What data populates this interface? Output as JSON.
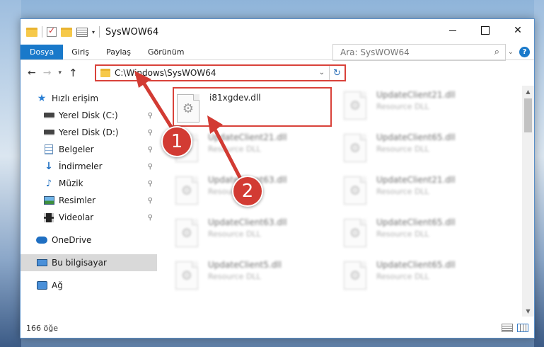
{
  "window": {
    "title": "SysWOW64",
    "buttons": {
      "minimize": "",
      "maximize": "",
      "close": "✕"
    }
  },
  "ribbon": {
    "tabs": [
      "Dosya",
      "Giriş",
      "Paylaş",
      "Görünüm"
    ],
    "help": "?",
    "expand": "⌄"
  },
  "nav": {
    "back": "←",
    "forward": "→",
    "recent": "▾",
    "up": "↑",
    "address": "C:\\Windows\\SysWOW64",
    "address_dropdown": "⌄",
    "refresh": "↻",
    "search_placeholder": "Ara: SysWOW64",
    "search_icon": "⌕"
  },
  "sidebar": {
    "items": [
      {
        "label": "Hızlı erişim",
        "icon": "star-icon",
        "pinned": false,
        "sub": false
      },
      {
        "label": "Yerel Disk (C:)",
        "icon": "drive-icon",
        "pinned": true,
        "sub": true
      },
      {
        "label": "Yerel Disk (D:)",
        "icon": "drive-icon",
        "pinned": true,
        "sub": true
      },
      {
        "label": "Belgeler",
        "icon": "documents-icon",
        "pinned": true,
        "sub": true
      },
      {
        "label": "İndirmeler",
        "icon": "download-icon",
        "pinned": true,
        "sub": true
      },
      {
        "label": "Müzik",
        "icon": "music-icon",
        "pinned": true,
        "sub": true
      },
      {
        "label": "Resimler",
        "icon": "pictures-icon",
        "pinned": true,
        "sub": true
      },
      {
        "label": "Videolar",
        "icon": "videos-icon",
        "pinned": true,
        "sub": true
      },
      {
        "label": "OneDrive",
        "icon": "onedrive-icon",
        "pinned": false,
        "sub": false
      },
      {
        "label": "Bu bilgisayar",
        "icon": "this-pc-icon",
        "pinned": false,
        "sub": false,
        "selected": true
      },
      {
        "label": "Ağ",
        "icon": "network-icon",
        "pinned": false,
        "sub": false
      }
    ],
    "pin_glyph": "📌"
  },
  "files": [
    {
      "name": "i81xgdev.dll",
      "type": "",
      "highlighted": true
    },
    {
      "name": "UpdateClient21.dll",
      "type": "Resource DLL"
    },
    {
      "name": "UpdateClient21.dll",
      "type": "Resource DLL"
    },
    {
      "name": "UpdateClient65.dll",
      "type": "Resource DLL"
    },
    {
      "name": "UpdateClient63.dll",
      "type": "Resource DLL"
    },
    {
      "name": "UpdateClient21.dll",
      "type": "Resource DLL"
    },
    {
      "name": "UpdateClient63.dll",
      "type": "Resource DLL"
    },
    {
      "name": "UpdateClient65.dll",
      "type": "Resource DLL"
    },
    {
      "name": "UpdateClient5.dll",
      "type": "Resource DLL"
    },
    {
      "name": "UpdateClient65.dll",
      "type": "Resource DLL"
    }
  ],
  "status": {
    "count": "166 öğe"
  },
  "callouts": [
    "1",
    "2"
  ],
  "colors": {
    "accent": "#1979ca",
    "highlight": "#d9423a",
    "callout": "#d23b33"
  }
}
